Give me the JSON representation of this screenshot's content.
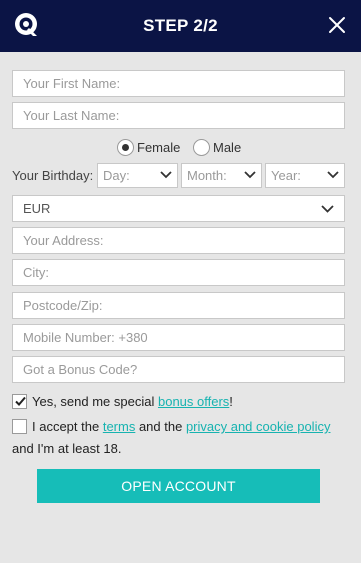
{
  "header": {
    "title": "STEP 2/2"
  },
  "form": {
    "first_name_placeholder": "Your First Name:",
    "last_name_placeholder": "Your Last Name:",
    "gender_female": "Female",
    "gender_male": "Male",
    "gender_selected": "Female",
    "birthday_label": "Your Birthday:",
    "day_label": "Day:",
    "month_label": "Month:",
    "year_label": "Year:",
    "currency_value": "EUR",
    "address_placeholder": "Your Address:",
    "city_placeholder": "City:",
    "postcode_placeholder": "Postcode/Zip:",
    "mobile_placeholder": "Mobile Number: +380",
    "bonus_code_placeholder": "Got a Bonus Code?",
    "offers_text_before": "Yes, send me special ",
    "offers_link": "bonus offers",
    "offers_text_after": "!",
    "offers_checked": true,
    "terms_text_1": "I accept the ",
    "terms_link": "terms",
    "terms_text_2": " and the ",
    "privacy_link": "privacy and cookie policy",
    "terms_text_3": " and I'm at least 18.",
    "terms_checked": false,
    "submit_label": "OPEN ACCOUNT"
  },
  "colors": {
    "header_bg": "#0b1445",
    "accent": "#16bdb8",
    "link": "#17b3b0",
    "page_bg": "#e6e6e6"
  }
}
